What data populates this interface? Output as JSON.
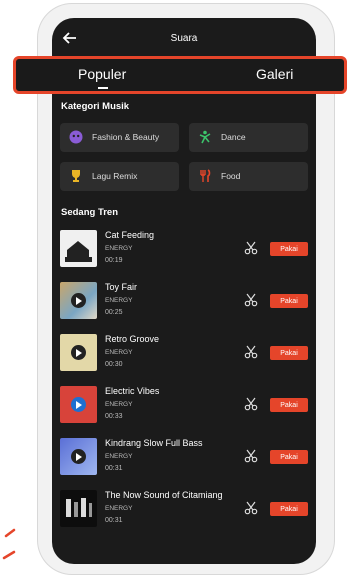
{
  "header": {
    "title": "Suara"
  },
  "tabs": [
    {
      "label": "Populer"
    },
    {
      "label": "Galeri"
    }
  ],
  "categories": {
    "heading": "Kategori Musik",
    "items": [
      {
        "label": "Fashion & Beauty",
        "icon": "purple-emoji-icon"
      },
      {
        "label": "Dance",
        "icon": "dancer-icon"
      },
      {
        "label": "Lagu Remix",
        "icon": "trophy-icon"
      },
      {
        "label": "Food",
        "icon": "fork-knife-icon"
      }
    ]
  },
  "trending": {
    "heading": "Sedang Tren",
    "tracks": [
      {
        "title": "Cat Feeding",
        "artist": "ENERGY",
        "duration": "00:19",
        "action": "Pakai"
      },
      {
        "title": "Toy Fair",
        "artist": "ENERGY",
        "duration": "00:25",
        "action": "Pakai"
      },
      {
        "title": "Retro Groove",
        "artist": "ENERGY",
        "duration": "00:30",
        "action": "Pakai"
      },
      {
        "title": "Electric Vibes",
        "artist": "ENERGY",
        "duration": "00:33",
        "action": "Pakai"
      },
      {
        "title": "Kindrang Slow Full Bass",
        "artist": "ENERGY",
        "duration": "00:31",
        "action": "Pakai"
      },
      {
        "title": "The Now Sound of Citamiang",
        "artist": "ENERGY",
        "duration": "00:31",
        "action": "Pakai"
      }
    ]
  },
  "colors": {
    "accent": "#e5452a",
    "background": "#1b1b1b",
    "card": "#2d2d2d"
  }
}
